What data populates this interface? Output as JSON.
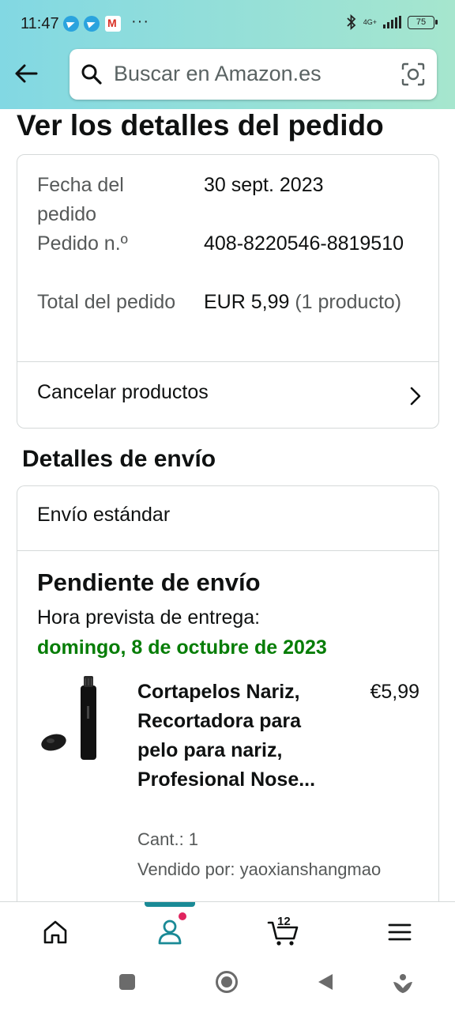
{
  "status_bar": {
    "time": "11:47",
    "dots": "···",
    "network": "4G+",
    "battery": "75"
  },
  "header": {
    "search_placeholder": "Buscar en Amazon.es"
  },
  "page": {
    "title": "Ver los detalles del pedido"
  },
  "order": {
    "date_label": "Fecha del pedido",
    "date_value": "30 sept. 2023",
    "number_label": "Pedido n.º",
    "number_value": "408-8220546-8819510",
    "total_label": "Total del pedido",
    "total_value": "EUR 5,99",
    "total_count": "(1 producto)",
    "cancel_label": "Cancelar productos"
  },
  "shipping": {
    "section_title": "Detalles de envío",
    "type": "Envío estándar",
    "status": "Pendiente de envío",
    "eta_label": "Hora prevista de entrega:",
    "eta_date": "domingo, 8 de octubre de 2023",
    "product": {
      "title": "Cortapelos Nariz, Recortadora para pelo para nariz, Profesional Nose...",
      "price": "€5,99",
      "quantity": "Cant.: 1",
      "seller": "Vendido por: yaoxianshangmao"
    }
  },
  "bottom_nav": {
    "items": [
      "home-icon",
      "account-icon",
      "cart-icon",
      "menu-icon"
    ],
    "cart_count": "12"
  },
  "colors": {
    "accent_teal": "#1a8a96",
    "delivery_green": "#067d06",
    "badge_pink": "#e0245e"
  }
}
